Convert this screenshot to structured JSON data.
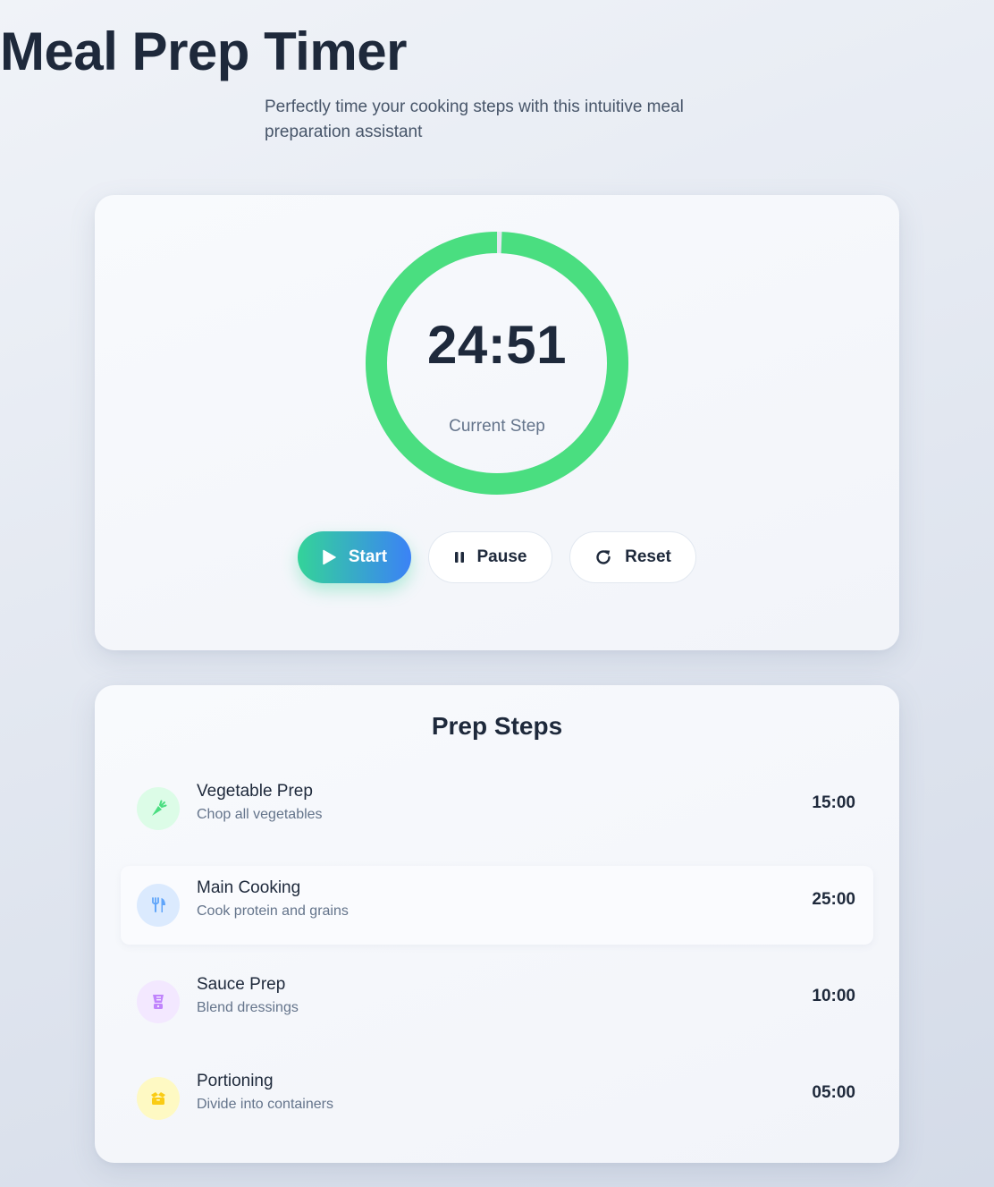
{
  "header": {
    "title": "Meal Prep Timer",
    "subtitle": "Perfectly time your cooking steps with this intuitive meal preparation assistant"
  },
  "timer": {
    "time": "24:51",
    "label": "Current Step",
    "progress_remaining": 0.994,
    "ring_color": "#4ade80"
  },
  "controls": {
    "start_label": "Start",
    "pause_label": "Pause",
    "reset_label": "Reset"
  },
  "steps": {
    "title": "Prep Steps",
    "items": [
      {
        "name": "Vegetable Prep",
        "description": "Chop all vegetables",
        "duration": "15:00",
        "icon": "carrot-icon",
        "color": "#4ade80",
        "bg": "#dcfce7",
        "active": false
      },
      {
        "name": "Main Cooking",
        "description": "Cook protein and grains",
        "duration": "25:00",
        "icon": "utensils-icon",
        "color": "#60a5fa",
        "bg": "#dbeafe",
        "active": true
      },
      {
        "name": "Sauce Prep",
        "description": "Blend dressings",
        "duration": "10:00",
        "icon": "blender-icon",
        "color": "#c084fc",
        "bg": "#f3e8ff",
        "active": false
      },
      {
        "name": "Portioning",
        "description": "Divide into containers",
        "duration": "05:00",
        "icon": "box-icon",
        "color": "#facc15",
        "bg": "#fef9c3",
        "active": false
      }
    ]
  }
}
